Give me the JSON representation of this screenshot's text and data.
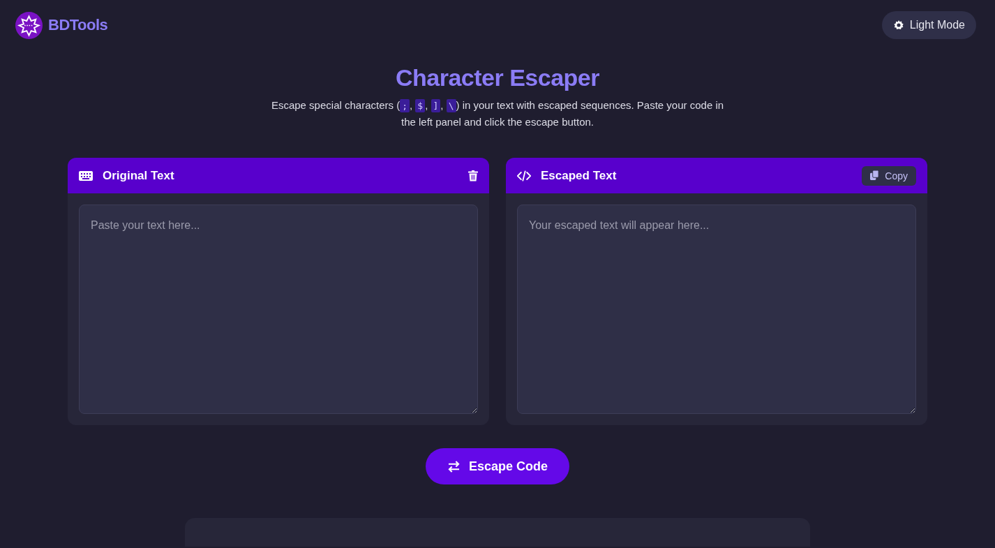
{
  "brand": {
    "name": "BDTools"
  },
  "theme_toggle": {
    "label": "Light Mode"
  },
  "title": "Character Escaper",
  "description": [
    {
      "kind": "text",
      "text": "Escape special characters ("
    },
    {
      "kind": "code",
      "text": ";"
    },
    {
      "kind": "text",
      "text": ", "
    },
    {
      "kind": "code",
      "text": "$"
    },
    {
      "kind": "text",
      "text": ", "
    },
    {
      "kind": "code",
      "text": "]"
    },
    {
      "kind": "text",
      "text": ", "
    },
    {
      "kind": "code",
      "text": "\\"
    },
    {
      "kind": "text",
      "text": ") in your text with escaped sequences. Paste your code in the left panel and click the escape button."
    }
  ],
  "panels": [
    {
      "kind": "input",
      "title": "Original Text",
      "placeholder": "Paste your text here..."
    },
    {
      "kind": "output",
      "title": "Escaped Text",
      "action": "Copy",
      "placeholder": "Your escaped text will appear here..."
    }
  ],
  "escape_button": {
    "label": "Escape Code"
  },
  "rules_card": {
    "kind": "card"
  }
}
